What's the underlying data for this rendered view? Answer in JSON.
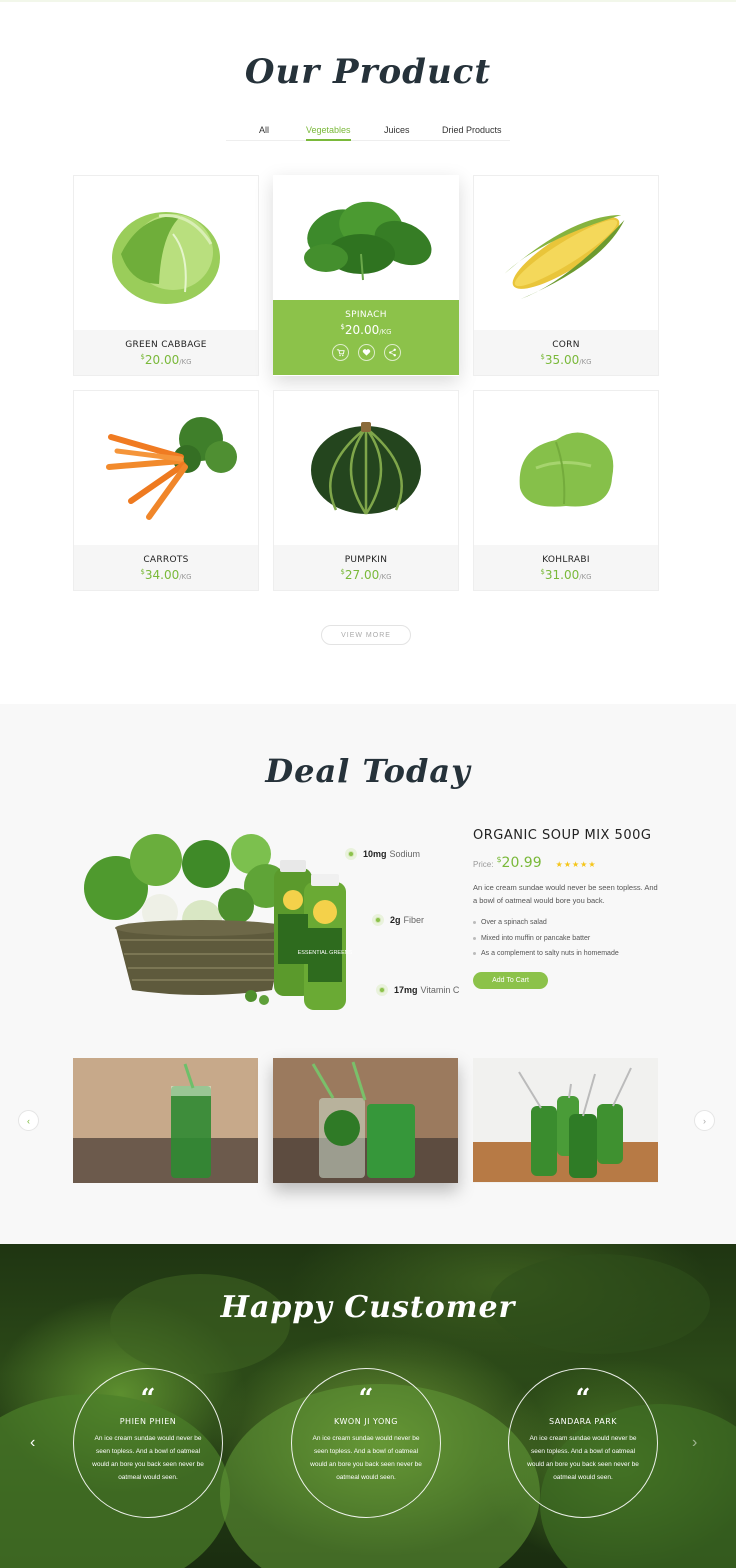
{
  "products_section": {
    "title": "Our Product",
    "tabs": [
      {
        "label": "All",
        "active": false
      },
      {
        "label": "Vegetables",
        "active": true
      },
      {
        "label": "Juices",
        "active": false
      },
      {
        "label": "Dried Products",
        "active": false
      }
    ],
    "products": [
      {
        "name": "GREEN CABBAGE",
        "currency": "$",
        "price": "20.00",
        "unit": "/KG"
      },
      {
        "name": "SPINACH",
        "currency": "$",
        "price": "20.00",
        "unit": "/KG"
      },
      {
        "name": "CORN",
        "currency": "$",
        "price": "35.00",
        "unit": "/KG"
      },
      {
        "name": "CARROTS",
        "currency": "$",
        "price": "34.00",
        "unit": "/KG"
      },
      {
        "name": "PUMPKIN",
        "currency": "$",
        "price": "27.00",
        "unit": "/KG"
      },
      {
        "name": "KOHLRABI",
        "currency": "$",
        "price": "31.00",
        "unit": "/KG"
      }
    ],
    "featured_actions": [
      "cart-icon",
      "heart-icon",
      "share-icon"
    ],
    "view_more_label": "VIEW MORE"
  },
  "deal_section": {
    "title": "Deal Today",
    "callouts": [
      {
        "value": "10mg",
        "label": "Sodium"
      },
      {
        "value": "2g",
        "label": "Fiber"
      },
      {
        "value": "17mg",
        "label": "Vitamin C"
      }
    ],
    "bottle_label": "ESSENTIAL GREENS",
    "product_title": "ORGANIC SOUP MIX 500G",
    "price_label": "Price:",
    "currency": "$",
    "price": "20.99",
    "rating": 5,
    "stars": "★★★★★",
    "description": "An ice cream sundae would never be seen topless. And a bowl of oatmeal would bore you back.",
    "features": [
      "Over a spinach salad",
      "Mixed into muffin or pancake batter",
      "As a complement to salty nuts in homemade"
    ],
    "cta_label": "Add To Cart",
    "nav": {
      "prev": "‹",
      "next": "›"
    }
  },
  "customers_section": {
    "title": "Happy Customer",
    "quote_mark": "“",
    "testimonials": [
      {
        "name": "PHIEN PHIEN",
        "text": "An ice cream sundae would never be seen topless. And a bowl of oatmeal would an bore you back seen never be oatmeal would seen."
      },
      {
        "name": "KWON JI YONG",
        "text": "An ice cream sundae would never be seen topless. And a bowl of oatmeal would an bore you back seen never be oatmeal would seen."
      },
      {
        "name": "SANDARA PARK",
        "text": "An ice cream sundae would never be seen topless. And a bowl of oatmeal would an bore you back seen never be oatmeal would seen."
      }
    ],
    "nav": {
      "prev": "‹",
      "next": "›"
    }
  },
  "colors": {
    "accent": "#8cc24a",
    "accent_text": "#7ab93a",
    "heading": "#26323a",
    "star": "#f5c518"
  }
}
